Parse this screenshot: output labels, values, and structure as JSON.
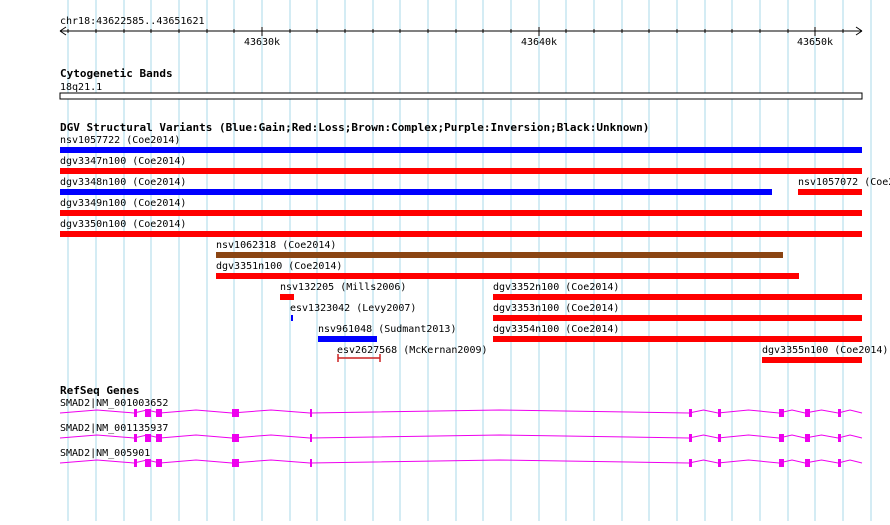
{
  "ruler": {
    "locus": "chr18:43622585..43651621",
    "ticks": [
      "43630k",
      "43640k",
      "43650k"
    ]
  },
  "tracks": {
    "cytoband": {
      "title": "Cytogenetic Bands",
      "band": "18q21.1"
    },
    "dgv": {
      "title": "DGV Structural Variants (Blue:Gain;Red:Loss;Brown:Complex;Purple:Inversion;Black:Unknown)",
      "colors": {
        "gain": "#0000ff",
        "loss": "#ff0000",
        "complex": "#8b4513",
        "tick": "#cc2222"
      },
      "features": [
        {
          "label": "nsv1057722 (Coe2014)",
          "type": "gain",
          "style": "bar"
        },
        {
          "label": "dgv3347n100 (Coe2014)",
          "type": "loss",
          "style": "bar"
        },
        {
          "label": "dgv3348n100 (Coe2014)",
          "type": "gain",
          "style": "bar"
        },
        {
          "label": "nsv1057072 (Coe2",
          "type": "loss",
          "style": "bar"
        },
        {
          "label": "dgv3349n100 (Coe2014)",
          "type": "loss",
          "style": "bar"
        },
        {
          "label": "dgv3350n100 (Coe2014)",
          "type": "loss",
          "style": "bar"
        },
        {
          "label": "nsv1062318 (Coe2014)",
          "type": "complex",
          "style": "bar"
        },
        {
          "label": "dgv3351n100 (Coe2014)",
          "type": "loss",
          "style": "bar"
        },
        {
          "label": "nsv132205 (Mills2006)",
          "type": "loss",
          "style": "bar"
        },
        {
          "label": "esv1323042 (Levy2007)",
          "type": "gain",
          "style": "bar"
        },
        {
          "label": "nsv961048 (Sudmant2013)",
          "type": "gain",
          "style": "bar"
        },
        {
          "label": "esv2627568 (McKernan2009)",
          "type": "loss",
          "style": "range"
        },
        {
          "label": "dgv3352n100 (Coe2014)",
          "type": "loss",
          "style": "bar"
        },
        {
          "label": "dgv3353n100 (Coe2014)",
          "type": "loss",
          "style": "bar"
        },
        {
          "label": "dgv3354n100 (Coe2014)",
          "type": "loss",
          "style": "bar"
        },
        {
          "label": "dgv3355n100 (Coe2014)",
          "type": "loss",
          "style": "bar"
        }
      ]
    },
    "refseq": {
      "title": "RefSeq Genes",
      "color": "#ee00ee",
      "transcripts": [
        {
          "label": "SMAD2|NM_001003652"
        },
        {
          "label": "SMAD2|NM_001135937"
        },
        {
          "label": "SMAD2|NM_005901"
        }
      ]
    }
  }
}
